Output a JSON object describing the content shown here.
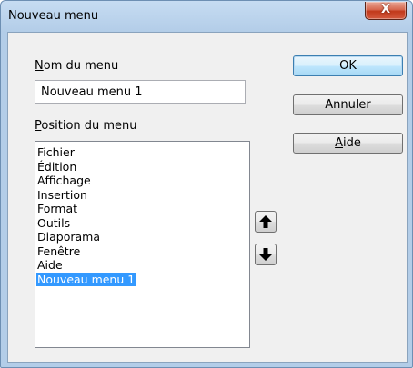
{
  "window": {
    "title": "Nouveau menu",
    "close_symbol": "X"
  },
  "name_section": {
    "label_accel": "N",
    "label_rest": "om du menu",
    "input_value": "Nouveau menu 1"
  },
  "position_section": {
    "label_accel": "P",
    "label_rest": "osition du menu",
    "items": [
      "Fichier",
      "Édition",
      "Affichage",
      "Insertion",
      "Format",
      "Outils",
      "Diaporama",
      "Fenêtre",
      "Aide",
      "Nouveau menu 1"
    ],
    "selected_index": 9
  },
  "buttons": {
    "ok": "OK",
    "cancel": "Annuler",
    "help_accel": "A",
    "help_rest": "ide"
  },
  "icons": {
    "move_up": "arrow-up-icon",
    "move_down": "arrow-down-icon"
  },
  "colors": {
    "selection": "#3399ff",
    "close_button": "#c1391b"
  }
}
